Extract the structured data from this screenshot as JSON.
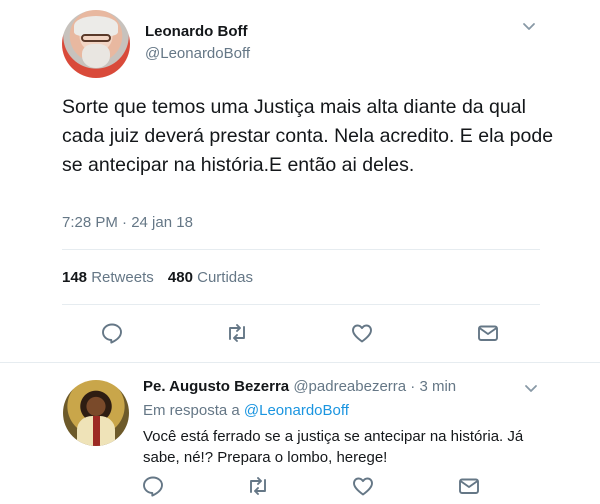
{
  "main_tweet": {
    "author_name": "Leonardo Boff",
    "author_handle": "@LeonardoBoff",
    "text": "Sorte que temos uma Justiça mais alta diante da qual cada juiz deverá prestar conta. Nela acredito. E ela pode se antecipar na história.E então ai deles.",
    "timestamp": "7:28 PM · 24 jan 18",
    "retweets_count": "148",
    "retweets_label": "Retweets",
    "likes_count": "480",
    "likes_label": "Curtidas"
  },
  "reply": {
    "author_name": "Pe. Augusto Bezerra",
    "author_handle": "@padreabezerra",
    "time_ago": "· 3 min",
    "in_reply_prefix": "Em resposta a",
    "in_reply_handle": "@LeonardoBoff",
    "text": "Você está ferrado se a justiça se antecipar na história. Já sabe, né!? Prepara o lombo, herege!"
  },
  "icons": {
    "reply": "reply-icon",
    "retweet": "retweet-icon",
    "like": "heart-icon",
    "message": "envelope-icon",
    "caret": "chevron-down-icon"
  },
  "colors": {
    "text_primary": "#14171a",
    "text_secondary": "#657786",
    "link": "#1b95e0",
    "divider": "#e6ecf0"
  }
}
